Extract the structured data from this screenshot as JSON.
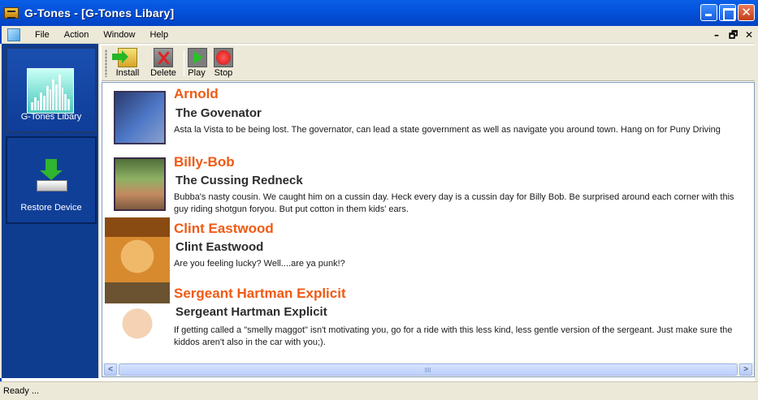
{
  "window": {
    "title": "G-Tones - [G-Tones Libary]"
  },
  "menu": {
    "items": [
      "File",
      "Action",
      "Window",
      "Help"
    ],
    "mdi_minimize": "–",
    "mdi_restore": "🗗",
    "mdi_close": "✕"
  },
  "sidebar": {
    "items": [
      {
        "label": "G-Tones Libary",
        "icon": "tones-library-icon",
        "active": true
      },
      {
        "label": "Restore Device",
        "icon": "restore-device-icon",
        "active": false
      }
    ]
  },
  "toolbar": {
    "buttons": [
      {
        "label": "Install",
        "icon": "install-icon"
      },
      {
        "label": "Delete",
        "icon": "delete-icon"
      },
      {
        "label": "Play",
        "icon": "play-icon"
      },
      {
        "label": "Stop",
        "icon": "stop-icon"
      }
    ]
  },
  "tones": [
    {
      "name": "Arnold",
      "subtitle": "The Govenator",
      "description": "Asta la Vista to be being lost. The governator, can lead a state government as well as navigate you around town. Hang on for Puny Driving"
    },
    {
      "name": "Billy-Bob",
      "subtitle": "The Cussing Redneck",
      "description": "Bubba's nasty cousin. We caught him on a cussin day. Heck every day is a cussin day for Billy Bob. Be surprised around each corner with this guy riding shotgun foryou. But put cotton in them kids' ears."
    },
    {
      "name": "Clint Eastwood",
      "subtitle": "Clint Eastwood",
      "description": "Are you feeling lucky?  Well....are ya punk!?"
    },
    {
      "name": "Sergeant Hartman Explicit",
      "subtitle": "Sergeant Hartman Explicit",
      "description": "If getting called a \"smelly maggot\" isn't motivating you, go for a ride with this less kind, less gentle version of the sergeant.  Just make sure the kiddos aren't also in the car with you;)."
    }
  ],
  "scrollbar": {
    "left_arrow": "<",
    "right_arrow": ">"
  },
  "status": {
    "text": "Ready ..."
  },
  "colors": {
    "title_bar": "#0453dc",
    "sidebar": "#0e3c8f",
    "tone_name": "#f05a14",
    "chrome": "#ece9d8"
  }
}
